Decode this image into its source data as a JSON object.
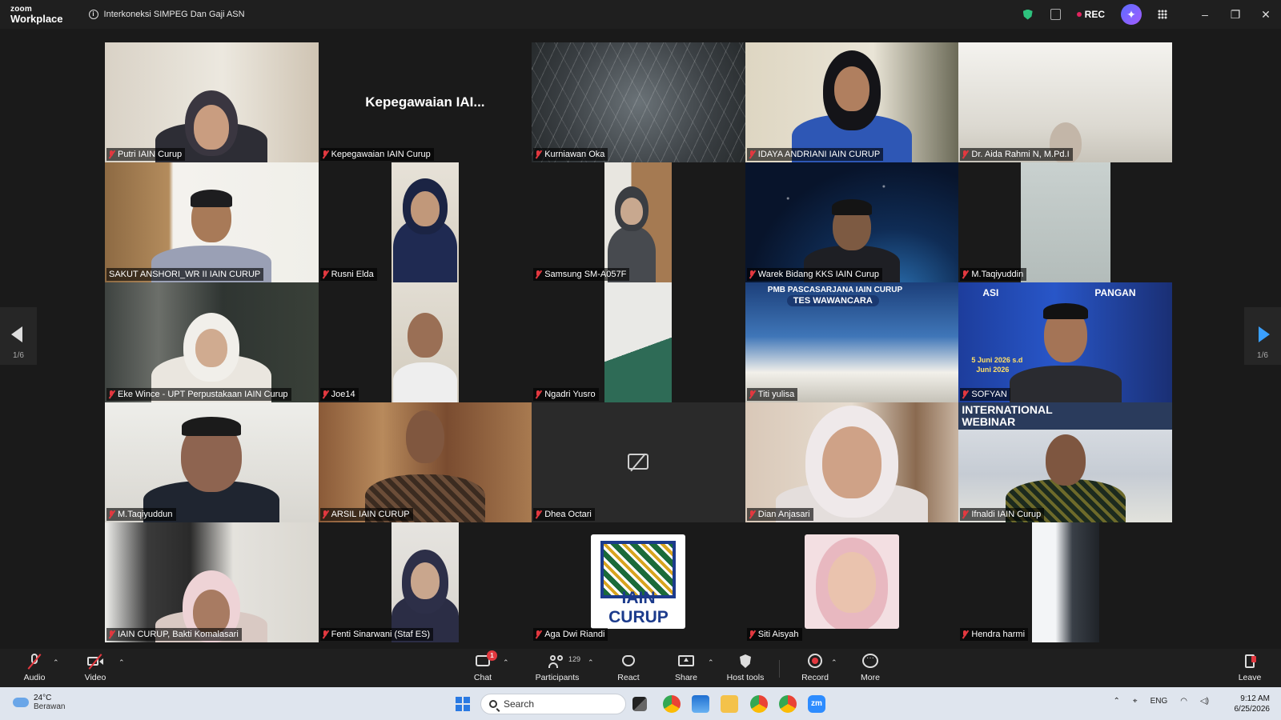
{
  "window": {
    "logo_top": "zoom",
    "logo_bottom": "Workplace",
    "meeting_title": "Interkoneksi SIMPEG Dan Gaji ASN",
    "rec_label": "REC",
    "controls": [
      "–",
      "❐",
      "✕"
    ]
  },
  "pagination": {
    "prev_page": "1/6",
    "next_page": "1/6"
  },
  "participants": [
    {
      "name": "Putri IAIN Curup"
    },
    {
      "name": "Kepegawaian IAIN Curup",
      "display_text": "Kepegawaian IAI..."
    },
    {
      "name": "Kurniawan Oka"
    },
    {
      "name": "IDAYA ANDRIANI IAIN CURUP"
    },
    {
      "name": "Dr. Aida Rahmi N, M.Pd.I"
    },
    {
      "name": "SAKUT ANSHORI_WR II IAIN CURUP",
      "active": true
    },
    {
      "name": "Rusni Elda"
    },
    {
      "name": "Samsung SM-A057F"
    },
    {
      "name": "Warek Bidang KKS IAIN Curup"
    },
    {
      "name": "M.Taqiyuddin"
    },
    {
      "name": "Eke Wince - UPT Perpustakaan IAIN Curup"
    },
    {
      "name": "Joe14"
    },
    {
      "name": "Ngadri Yusro"
    },
    {
      "name": "Titi yulisa",
      "poster_title": "PMB PASCASARJANA IAIN CURUP",
      "poster_subtitle": "TES WAWANCARA"
    },
    {
      "name": "SOFYAN",
      "poster_title": "ASI",
      "poster_title_right": "PANGAN",
      "poster_date": "5 Juni 2026 s.d",
      "poster_date2": "Juni 2026"
    },
    {
      "name": "M.Taqiyuddun"
    },
    {
      "name": "ARSIL IAIN CURUP"
    },
    {
      "name": "Dhea Octari"
    },
    {
      "name": "Dian Anjasari"
    },
    {
      "name": "Ifnaldi IAIN Curup",
      "poster_title": "INTERNATIONAL",
      "poster_subtitle": "WEBINAR"
    },
    {
      "name": "IAIN CURUP, Bakti Komalasari"
    },
    {
      "name": "Fenti Sinarwani (Staf ES)"
    },
    {
      "name": "Aga Dwi Riandi",
      "logo_text": "IAIN CURUP"
    },
    {
      "name": "Siti Aisyah"
    },
    {
      "name": "Hendra harmi"
    }
  ],
  "toolbar": {
    "audio": "Audio",
    "video": "Video",
    "chat": "Chat",
    "chat_badge": "1",
    "participants": "Participants",
    "participant_count": "129",
    "react": "React",
    "share": "Share",
    "host_tools": "Host tools",
    "record": "Record",
    "more": "More",
    "leave": "Leave"
  },
  "taskbar": {
    "temperature": "24°C",
    "weather": "Berawan",
    "search_placeholder": "Search",
    "language": "ENG",
    "time": "9:12 AM",
    "date": "6/25/2026"
  },
  "colors": {
    "active_speaker": "#2fd08a",
    "muted": "#e2383f",
    "nav_arrow_right": "#3aa0ff",
    "record": "#e2383f"
  }
}
